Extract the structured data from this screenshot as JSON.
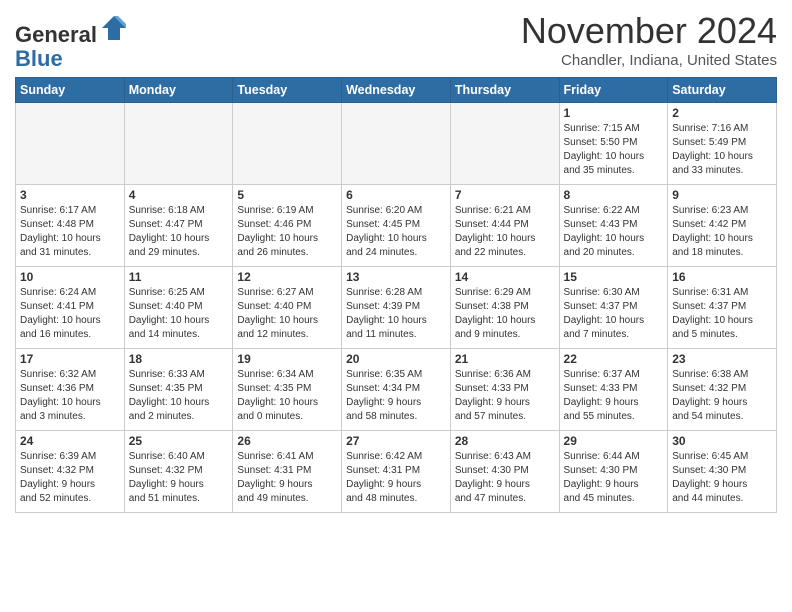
{
  "logo": {
    "general": "General",
    "blue": "Blue"
  },
  "title": "November 2024",
  "location": "Chandler, Indiana, United States",
  "days_of_week": [
    "Sunday",
    "Monday",
    "Tuesday",
    "Wednesday",
    "Thursday",
    "Friday",
    "Saturday"
  ],
  "weeks": [
    [
      {
        "day": "",
        "info": "",
        "empty": true
      },
      {
        "day": "",
        "info": "",
        "empty": true
      },
      {
        "day": "",
        "info": "",
        "empty": true
      },
      {
        "day": "",
        "info": "",
        "empty": true
      },
      {
        "day": "",
        "info": "",
        "empty": true
      },
      {
        "day": "1",
        "info": "Sunrise: 7:15 AM\nSunset: 5:50 PM\nDaylight: 10 hours\nand 35 minutes."
      },
      {
        "day": "2",
        "info": "Sunrise: 7:16 AM\nSunset: 5:49 PM\nDaylight: 10 hours\nand 33 minutes."
      }
    ],
    [
      {
        "day": "3",
        "info": "Sunrise: 6:17 AM\nSunset: 4:48 PM\nDaylight: 10 hours\nand 31 minutes."
      },
      {
        "day": "4",
        "info": "Sunrise: 6:18 AM\nSunset: 4:47 PM\nDaylight: 10 hours\nand 29 minutes."
      },
      {
        "day": "5",
        "info": "Sunrise: 6:19 AM\nSunset: 4:46 PM\nDaylight: 10 hours\nand 26 minutes."
      },
      {
        "day": "6",
        "info": "Sunrise: 6:20 AM\nSunset: 4:45 PM\nDaylight: 10 hours\nand 24 minutes."
      },
      {
        "day": "7",
        "info": "Sunrise: 6:21 AM\nSunset: 4:44 PM\nDaylight: 10 hours\nand 22 minutes."
      },
      {
        "day": "8",
        "info": "Sunrise: 6:22 AM\nSunset: 4:43 PM\nDaylight: 10 hours\nand 20 minutes."
      },
      {
        "day": "9",
        "info": "Sunrise: 6:23 AM\nSunset: 4:42 PM\nDaylight: 10 hours\nand 18 minutes."
      }
    ],
    [
      {
        "day": "10",
        "info": "Sunrise: 6:24 AM\nSunset: 4:41 PM\nDaylight: 10 hours\nand 16 minutes."
      },
      {
        "day": "11",
        "info": "Sunrise: 6:25 AM\nSunset: 4:40 PM\nDaylight: 10 hours\nand 14 minutes."
      },
      {
        "day": "12",
        "info": "Sunrise: 6:27 AM\nSunset: 4:40 PM\nDaylight: 10 hours\nand 12 minutes."
      },
      {
        "day": "13",
        "info": "Sunrise: 6:28 AM\nSunset: 4:39 PM\nDaylight: 10 hours\nand 11 minutes."
      },
      {
        "day": "14",
        "info": "Sunrise: 6:29 AM\nSunset: 4:38 PM\nDaylight: 10 hours\nand 9 minutes."
      },
      {
        "day": "15",
        "info": "Sunrise: 6:30 AM\nSunset: 4:37 PM\nDaylight: 10 hours\nand 7 minutes."
      },
      {
        "day": "16",
        "info": "Sunrise: 6:31 AM\nSunset: 4:37 PM\nDaylight: 10 hours\nand 5 minutes."
      }
    ],
    [
      {
        "day": "17",
        "info": "Sunrise: 6:32 AM\nSunset: 4:36 PM\nDaylight: 10 hours\nand 3 minutes."
      },
      {
        "day": "18",
        "info": "Sunrise: 6:33 AM\nSunset: 4:35 PM\nDaylight: 10 hours\nand 2 minutes."
      },
      {
        "day": "19",
        "info": "Sunrise: 6:34 AM\nSunset: 4:35 PM\nDaylight: 10 hours\nand 0 minutes."
      },
      {
        "day": "20",
        "info": "Sunrise: 6:35 AM\nSunset: 4:34 PM\nDaylight: 9 hours\nand 58 minutes."
      },
      {
        "day": "21",
        "info": "Sunrise: 6:36 AM\nSunset: 4:33 PM\nDaylight: 9 hours\nand 57 minutes."
      },
      {
        "day": "22",
        "info": "Sunrise: 6:37 AM\nSunset: 4:33 PM\nDaylight: 9 hours\nand 55 minutes."
      },
      {
        "day": "23",
        "info": "Sunrise: 6:38 AM\nSunset: 4:32 PM\nDaylight: 9 hours\nand 54 minutes."
      }
    ],
    [
      {
        "day": "24",
        "info": "Sunrise: 6:39 AM\nSunset: 4:32 PM\nDaylight: 9 hours\nand 52 minutes."
      },
      {
        "day": "25",
        "info": "Sunrise: 6:40 AM\nSunset: 4:32 PM\nDaylight: 9 hours\nand 51 minutes."
      },
      {
        "day": "26",
        "info": "Sunrise: 6:41 AM\nSunset: 4:31 PM\nDaylight: 9 hours\nand 49 minutes."
      },
      {
        "day": "27",
        "info": "Sunrise: 6:42 AM\nSunset: 4:31 PM\nDaylight: 9 hours\nand 48 minutes."
      },
      {
        "day": "28",
        "info": "Sunrise: 6:43 AM\nSunset: 4:30 PM\nDaylight: 9 hours\nand 47 minutes."
      },
      {
        "day": "29",
        "info": "Sunrise: 6:44 AM\nSunset: 4:30 PM\nDaylight: 9 hours\nand 45 minutes."
      },
      {
        "day": "30",
        "info": "Sunrise: 6:45 AM\nSunset: 4:30 PM\nDaylight: 9 hours\nand 44 minutes."
      }
    ]
  ]
}
